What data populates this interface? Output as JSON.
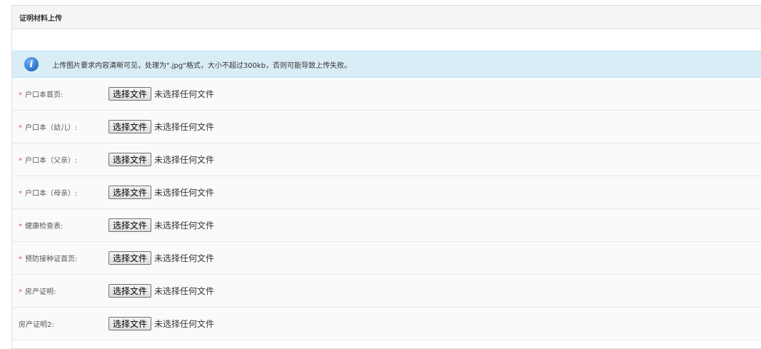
{
  "panel": {
    "title": "证明材料上传"
  },
  "alert": {
    "icon": "info-icon",
    "icon_glyph": "i",
    "text": "上传图片要求内容清晰可见，处理为\".jpg\"格式，大小不超过300kb，否则可能导致上传失败。"
  },
  "rows": [
    {
      "label": "户口本首页:",
      "required": true,
      "button": "选择文件",
      "status": "未选择任何文件"
    },
    {
      "label": "户口本（幼儿）:",
      "required": true,
      "button": "选择文件",
      "status": "未选择任何文件"
    },
    {
      "label": "户口本（父亲）:",
      "required": true,
      "button": "选择文件",
      "status": "未选择任何文件"
    },
    {
      "label": "户口本（母亲）:",
      "required": true,
      "button": "选择文件",
      "status": "未选择任何文件"
    },
    {
      "label": "健康检查表:",
      "required": true,
      "button": "选择文件",
      "status": "未选择任何文件"
    },
    {
      "label": "预防接种证首页:",
      "required": true,
      "button": "选择文件",
      "status": "未选择任何文件"
    },
    {
      "label": "房产证明:",
      "required": true,
      "button": "选择文件",
      "status": "未选择任何文件"
    },
    {
      "label": "房产证明2:",
      "required": false,
      "button": "选择文件",
      "status": "未选择任何文件"
    }
  ],
  "colors": {
    "required_marker": "#e05555",
    "alert_background": "#d9edf7",
    "icon_blue": "#2a73c9"
  }
}
